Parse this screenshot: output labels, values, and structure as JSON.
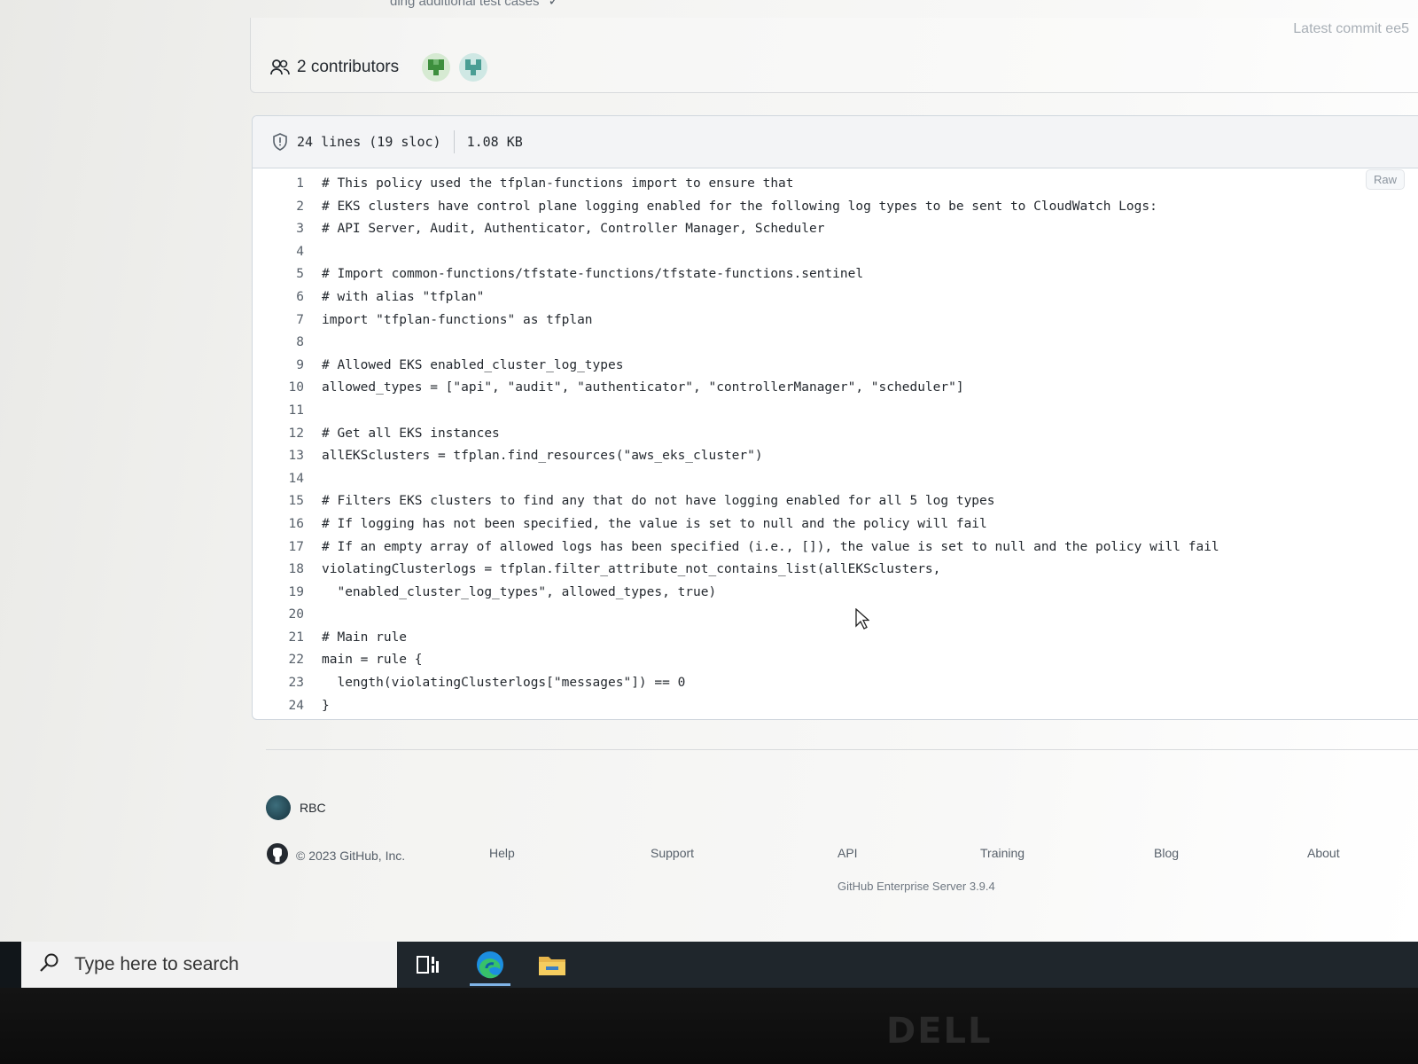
{
  "header": {
    "commit_message": "ding additional test cases",
    "latest_commit_label": "Latest commit ee5"
  },
  "contributors": {
    "label": "2 contributors",
    "avatars": [
      "green-identicon",
      "teal-identicon"
    ]
  },
  "file": {
    "lines_info": "24 lines (19 sloc)",
    "size": "1.08 KB",
    "raw_label": "Raw",
    "lines": [
      {
        "n": "1",
        "text": "# This policy used the tfplan-functions import to ensure that"
      },
      {
        "n": "2",
        "text": "# EKS clusters have control plane logging enabled for the following log types to be sent to CloudWatch Logs:"
      },
      {
        "n": "3",
        "text": "# API Server, Audit, Authenticator, Controller Manager, Scheduler"
      },
      {
        "n": "4",
        "text": ""
      },
      {
        "n": "5",
        "text": "# Import common-functions/tfstate-functions/tfstate-functions.sentinel"
      },
      {
        "n": "6",
        "text": "# with alias \"tfplan\""
      },
      {
        "n": "7",
        "text": "import \"tfplan-functions\" as tfplan"
      },
      {
        "n": "8",
        "text": ""
      },
      {
        "n": "9",
        "text": "# Allowed EKS enabled_cluster_log_types"
      },
      {
        "n": "10",
        "text": "allowed_types = [\"api\", \"audit\", \"authenticator\", \"controllerManager\", \"scheduler\"]"
      },
      {
        "n": "11",
        "text": ""
      },
      {
        "n": "12",
        "text": "# Get all EKS instances"
      },
      {
        "n": "13",
        "text": "allEKSclusters = tfplan.find_resources(\"aws_eks_cluster\")"
      },
      {
        "n": "14",
        "text": ""
      },
      {
        "n": "15",
        "text": "# Filters EKS clusters to find any that do not have logging enabled for all 5 log types"
      },
      {
        "n": "16",
        "text": "# If logging has not been specified, the value is set to null and the policy will fail"
      },
      {
        "n": "17",
        "text": "# If an empty array of allowed logs has been specified (i.e., []), the value is set to null and the policy will fail"
      },
      {
        "n": "18",
        "text": "violatingClusterlogs = tfplan.filter_attribute_not_contains_list(allEKSclusters,"
      },
      {
        "n": "19",
        "text": "  \"enabled_cluster_log_types\", allowed_types, true)"
      },
      {
        "n": "20",
        "text": ""
      },
      {
        "n": "21",
        "text": "# Main rule"
      },
      {
        "n": "22",
        "text": "main = rule {"
      },
      {
        "n": "23",
        "text": "  length(violatingClusterlogs[\"messages\"]) == 0"
      },
      {
        "n": "24",
        "text": "}"
      }
    ]
  },
  "org": {
    "name": "RBC"
  },
  "footer": {
    "copyright": "© 2023 GitHub, Inc.",
    "links": [
      "Help",
      "Support",
      "API",
      "Training",
      "Blog",
      "About"
    ],
    "server_version": "GitHub Enterprise Server 3.9.4"
  },
  "taskbar": {
    "search_placeholder": "Type here to search",
    "apps": [
      "task-view-icon",
      "edge-icon",
      "file-explorer-icon"
    ]
  },
  "monitor": {
    "brand": "DELL"
  }
}
